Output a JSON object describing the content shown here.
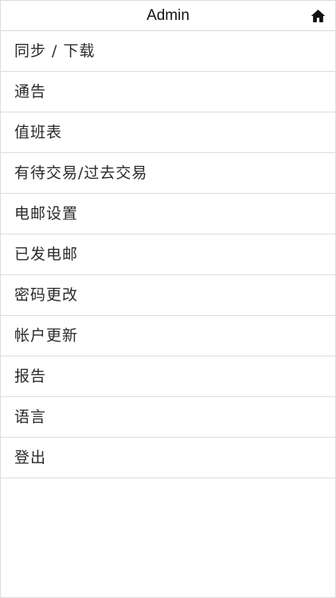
{
  "header": {
    "title": "Admin",
    "home_icon": "home-icon"
  },
  "menu": {
    "items": [
      {
        "label": "同步 / 下载"
      },
      {
        "label": "通告"
      },
      {
        "label": "值班表"
      },
      {
        "label": "有待交易/过去交易"
      },
      {
        "label": "电邮设置"
      },
      {
        "label": "已发电邮"
      },
      {
        "label": "密码更改"
      },
      {
        "label": "帐户更新"
      },
      {
        "label": "报告"
      },
      {
        "label": "语言"
      },
      {
        "label": "登出"
      }
    ]
  }
}
